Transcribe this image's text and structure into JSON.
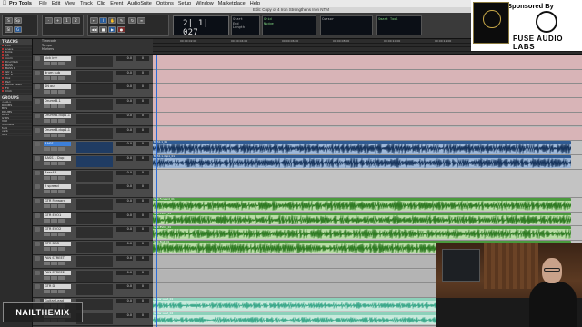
{
  "menubar": {
    "app_name": "Pro Tools",
    "items": [
      "File",
      "Edit",
      "View",
      "Track",
      "Clip",
      "Event",
      "AudioSuite",
      "Options",
      "Setup",
      "Window",
      "Marketplace",
      "Help"
    ]
  },
  "window": {
    "title": "Edit: Copy of 4 Iron Strengthens Iron NTM"
  },
  "transport": {
    "main_counter": "2| 1| 027",
    "start_label": "Start",
    "end_label": "End",
    "length_label": "Length",
    "grid_label": "Grid",
    "nudge_label": "Nudge",
    "cursor_label": "Cursor",
    "sample_rate_label": "Smart Tool"
  },
  "panels": {
    "tracks_title": "TRACKS",
    "groups_title": "GROUPS"
  },
  "track_list": [
    "kick",
    "snare",
    "toms",
    "oh",
    "room",
    "DrumSub",
    "BASS",
    "BASS 1",
    "Gtr L",
    "Gtr R",
    "Vox",
    "Pad",
    "Guitar Lead",
    "FX",
    "Click"
  ],
  "group_list": [
    "<ALL>",
    "ROOMS",
    "BUS",
    "DRUMS",
    "BASS",
    "GTRS",
    "VOX",
    "drumsAll",
    "fuzz",
    "verb",
    "gtrs"
  ],
  "ruler": {
    "rows": [
      "Timecode",
      "Tempo",
      "Markers"
    ],
    "ticks": [
      "00:00:02:00",
      "00:00:04:00",
      "00:00:06:00",
      "00:00:08:00",
      "00:00:10:00",
      "00:00:12:00",
      "00:00:14:00",
      "00:00:16:00"
    ]
  },
  "tracks": [
    {
      "name": "kick in+",
      "volume": "0.0",
      "pan": "0",
      "lane": "pink"
    },
    {
      "name": "drum sub",
      "volume": "0.0",
      "pan": "0",
      "lane": "pink"
    },
    {
      "name": "SN out",
      "volume": "0.0",
      "pan": "0",
      "lane": "pink"
    },
    {
      "name": "DrumsB.1",
      "volume": "0.0",
      "pan": "0",
      "lane": "pink"
    },
    {
      "name": "DrumsB.dup1.1",
      "volume": "0.0",
      "pan": "0",
      "lane": "pink"
    },
    {
      "name": "DrumsB.dup1.1",
      "volume": "0.0",
      "pan": "0",
      "lane": "pink"
    },
    {
      "name": "BASS 1",
      "volume": "0.0",
      "pan": "0",
      "lane": "blue",
      "clip": "BASS 1_01"
    },
    {
      "name": "BASS 1 Dup",
      "volume": "0.0",
      "pan": "0",
      "lane": "blue",
      "clip": "BASS 1.dup1_01"
    },
    {
      "name": "Bass4B",
      "volume": "0.0",
      "pan": "0",
      "lane": "empty"
    },
    {
      "name": "2 spread",
      "volume": "0.0",
      "pan": "0",
      "lane": "empty"
    },
    {
      "name": "GTR Forward",
      "volume": "0.0",
      "pan": "0",
      "lane": "green",
      "clip": "GTR Forward_01"
    },
    {
      "name": "GTR EVO1",
      "volume": "0.0",
      "pan": "0",
      "lane": "green",
      "clip": "GTR EVO1_01"
    },
    {
      "name": "GTR EVO2",
      "volume": "0.0",
      "pan": "0",
      "lane": "green",
      "clip": "GTR EVO2_01"
    },
    {
      "name": "GTR BGR",
      "volume": "0.0",
      "pan": "0",
      "lane": "green",
      "clip": "GTR BGR_01"
    },
    {
      "name": "PAN STREET",
      "volume": "0.0",
      "pan": "0",
      "lane": "blank"
    },
    {
      "name": "PAN STREE2",
      "volume": "0.0",
      "pan": "0",
      "lane": "blank"
    },
    {
      "name": "GTR DI",
      "volume": "0.0",
      "pan": "0",
      "lane": "blank"
    },
    {
      "name": "Guitar Lead",
      "volume": "0.0",
      "pan": "0",
      "lane": "teal",
      "clip": "Guitar Lead_01"
    },
    {
      "name": "Guitar Lead 2",
      "volume": "0.0",
      "pan": "0",
      "lane": "teal",
      "clip": "Guitar Lead_02"
    }
  ],
  "sponsor": {
    "label": "Sponsored By",
    "brand": "FUSE AUDIO LABS"
  },
  "watermark": {
    "text": "NAILTHEMIX"
  },
  "colors": {
    "bass_clip": "#2f5b93",
    "gtr_clip": "#4a9a3d",
    "lead_clip": "#8cd1ba",
    "selection": "#3d7fd8"
  }
}
